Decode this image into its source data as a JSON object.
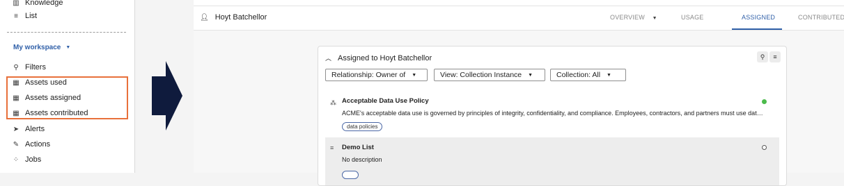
{
  "sidebar": {
    "items_top": [
      {
        "icon": "book-icon",
        "glyph": "▥",
        "label": "Knowledge"
      },
      {
        "icon": "list-icon",
        "glyph": "≡",
        "label": "List"
      }
    ],
    "workspace_label": "My workspace",
    "items": [
      {
        "icon": "filter-icon",
        "glyph": "⚲",
        "label": "Filters"
      },
      {
        "icon": "table-icon",
        "glyph": "▦",
        "label": "Assets used"
      },
      {
        "icon": "table-icon",
        "glyph": "▦",
        "label": "Assets assigned"
      },
      {
        "icon": "table-icon",
        "glyph": "▦",
        "label": "Assets contributed"
      },
      {
        "icon": "arrow-right-icon",
        "glyph": "➤",
        "label": "Alerts"
      },
      {
        "icon": "pencil-icon",
        "glyph": "✎",
        "label": "Actions"
      },
      {
        "icon": "grid-icon",
        "glyph": "⁘",
        "label": "Jobs"
      }
    ]
  },
  "main": {
    "user_name": "Hoyt Batchellor",
    "tabs": [
      {
        "label": "OVERVIEW",
        "dropdown": true,
        "active": false
      },
      {
        "label": "USAGE",
        "active": false
      },
      {
        "label": "ASSIGNED",
        "active": true
      },
      {
        "label": "CONTRIBUTED",
        "active": false
      }
    ],
    "card": {
      "title": "Assigned to Hoyt Batchellor",
      "filters": [
        {
          "label": "Relationship: Owner of"
        },
        {
          "label": "View: Collection Instance"
        },
        {
          "label": "Collection: All"
        }
      ],
      "assets": [
        {
          "name": "Acceptable Data Use Policy",
          "description": "ACME's acceptable data use is governed by principles of integrity, confidentiality, and compliance. Employees, contractors, and partners must use dat…",
          "tag": "data policies",
          "status": "active"
        },
        {
          "name": "Demo List",
          "description": "No description",
          "tag": "",
          "status": "inactive"
        }
      ]
    }
  },
  "colors": {
    "accent": "#2f5fa8",
    "highlight": "#e8703a",
    "arrow": "#0f1b3d",
    "status_active": "#4cbb4c"
  }
}
